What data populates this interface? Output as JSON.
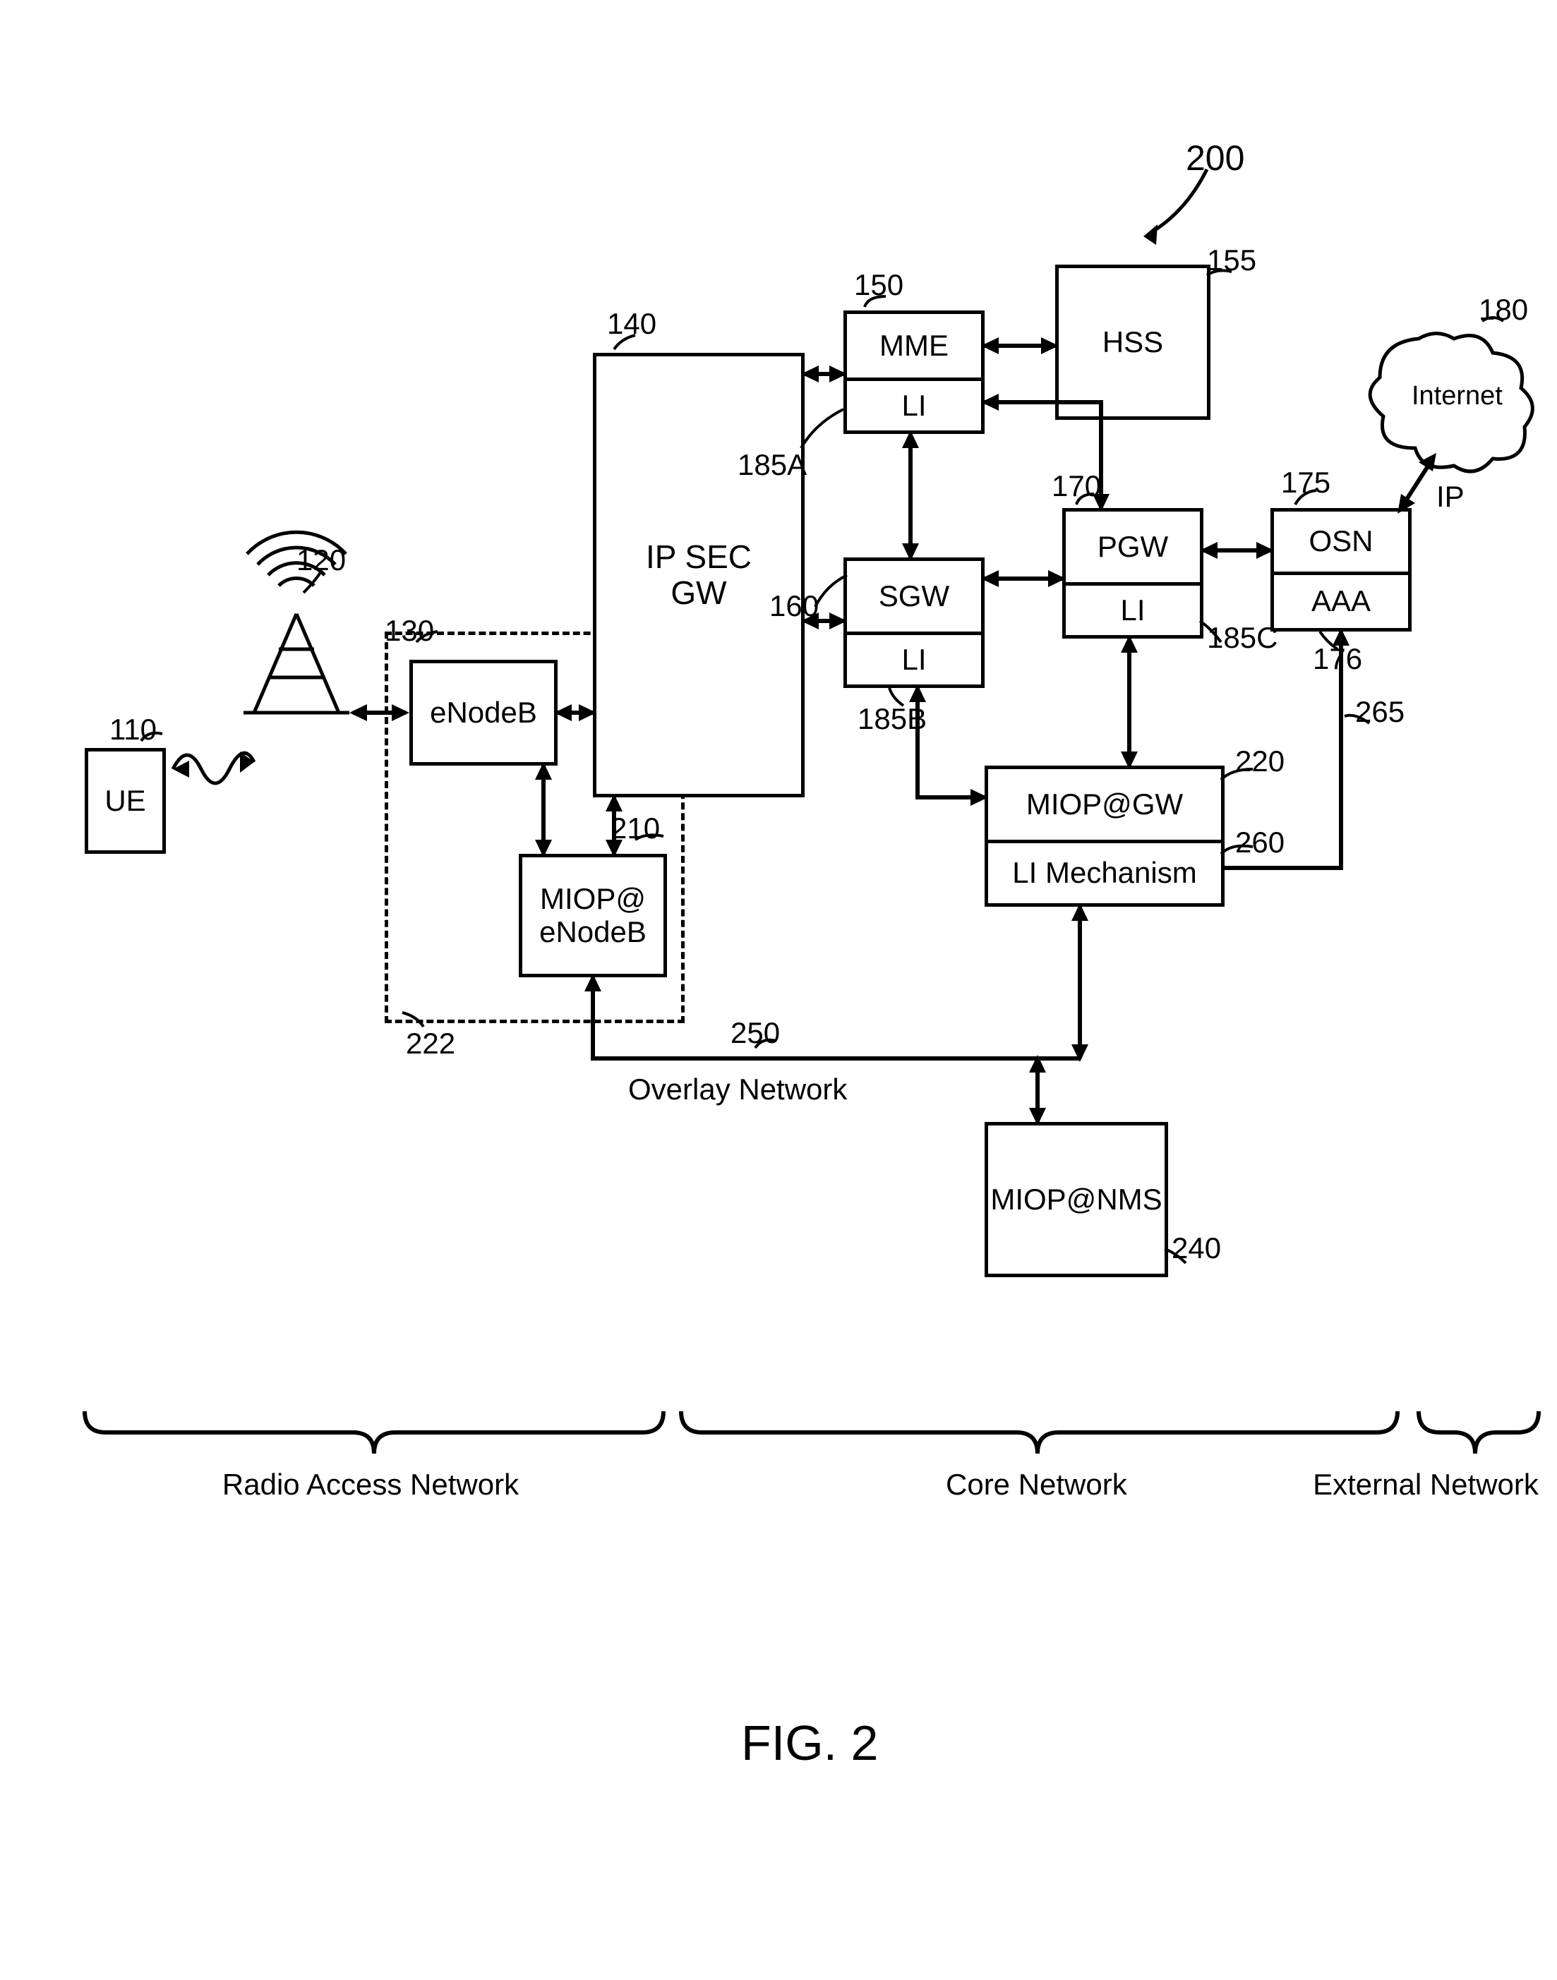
{
  "figure": {
    "caption": "FIG. 2",
    "main_ref": "200"
  },
  "nodes": {
    "ue": {
      "label": "UE",
      "ref": "110"
    },
    "enodeb": {
      "label": "eNodeB",
      "ref": "130"
    },
    "miop_enb": {
      "label": "MIOP@\neNodeB",
      "ref": "210"
    },
    "ipsec": {
      "label": "IP SEC\nGW",
      "ref": "140"
    },
    "mme": {
      "label": "MME",
      "ref": "150"
    },
    "mme_li": {
      "label": "LI",
      "ref": "185A"
    },
    "hss": {
      "label": "HSS",
      "ref": "155"
    },
    "sgw": {
      "label": "SGW",
      "ref": "160"
    },
    "sgw_li": {
      "label": "LI",
      "ref": "185B"
    },
    "pgw": {
      "label": "PGW",
      "ref": "170"
    },
    "pgw_li": {
      "label": "LI",
      "ref": "185C"
    },
    "osn": {
      "label": "OSN",
      "ref": "175"
    },
    "osn_aaa": {
      "label": "AAA",
      "ref": "176"
    },
    "internet": {
      "label": "Internet",
      "ref": "180"
    },
    "miop_gw": {
      "label": "MIOP@GW",
      "ref": "220"
    },
    "li_mech": {
      "label": "LI Mechanism",
      "ref": "260"
    },
    "miop_nms": {
      "label": "MIOP@NMS",
      "ref": "240"
    }
  },
  "groups": {
    "edge_node": {
      "ref": "222"
    }
  },
  "annotations": {
    "overlay_network": "Overlay Network",
    "overlay_ref": "250",
    "ip_link": "IP",
    "osn_li_ref": "265",
    "antenna_ref": "120"
  },
  "regions": {
    "ran": "Radio Access Network",
    "core": "Core Network",
    "ext": "External Network"
  }
}
